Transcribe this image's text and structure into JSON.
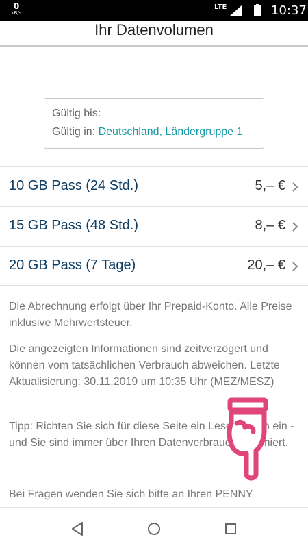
{
  "status_bar": {
    "speed_value": "0",
    "speed_unit": "kB/s",
    "network": "LTE",
    "time": "10:37"
  },
  "header": {
    "title": "Ihr Datenvolumen"
  },
  "validity": {
    "valid_until_label": "Gültig bis:",
    "valid_in_label": "Gültig in:",
    "valid_in_value": "Deutschland, Ländergruppe 1"
  },
  "passes": [
    {
      "name": "10 GB Pass (24 Std.)",
      "price": "5,– €"
    },
    {
      "name": "15 GB Pass (48 Std.)",
      "price": "8,– €"
    },
    {
      "name": "20 GB Pass (7 Tage)",
      "price": "20,– €"
    }
  ],
  "notes": {
    "billing": "Die Abrechnung erfolgt über Ihr Prepaid-Konto. Alle Preise inklusive Mehrwertsteuer.",
    "delay": "Die angezeigten Informationen sind zeitverzögert und können vom tatsächlichen Verbrauch abweichen. Letzte Aktualisierung: 30.11.2019 um 10:35 Uhr (MEZ/MESZ)",
    "tip": "Tipp: Richten Sie sich für diese Seite ein Lesezeichen ein - und Sie sind immer über Ihren Datenverbrauch informiert.",
    "questions": "Bei Fragen wenden Sie sich bitte an Ihren PENNY"
  },
  "icons": {
    "chevron": "chevron-right-icon",
    "hand": "pointing-hand-icon",
    "hand_color": "#e0457b"
  }
}
